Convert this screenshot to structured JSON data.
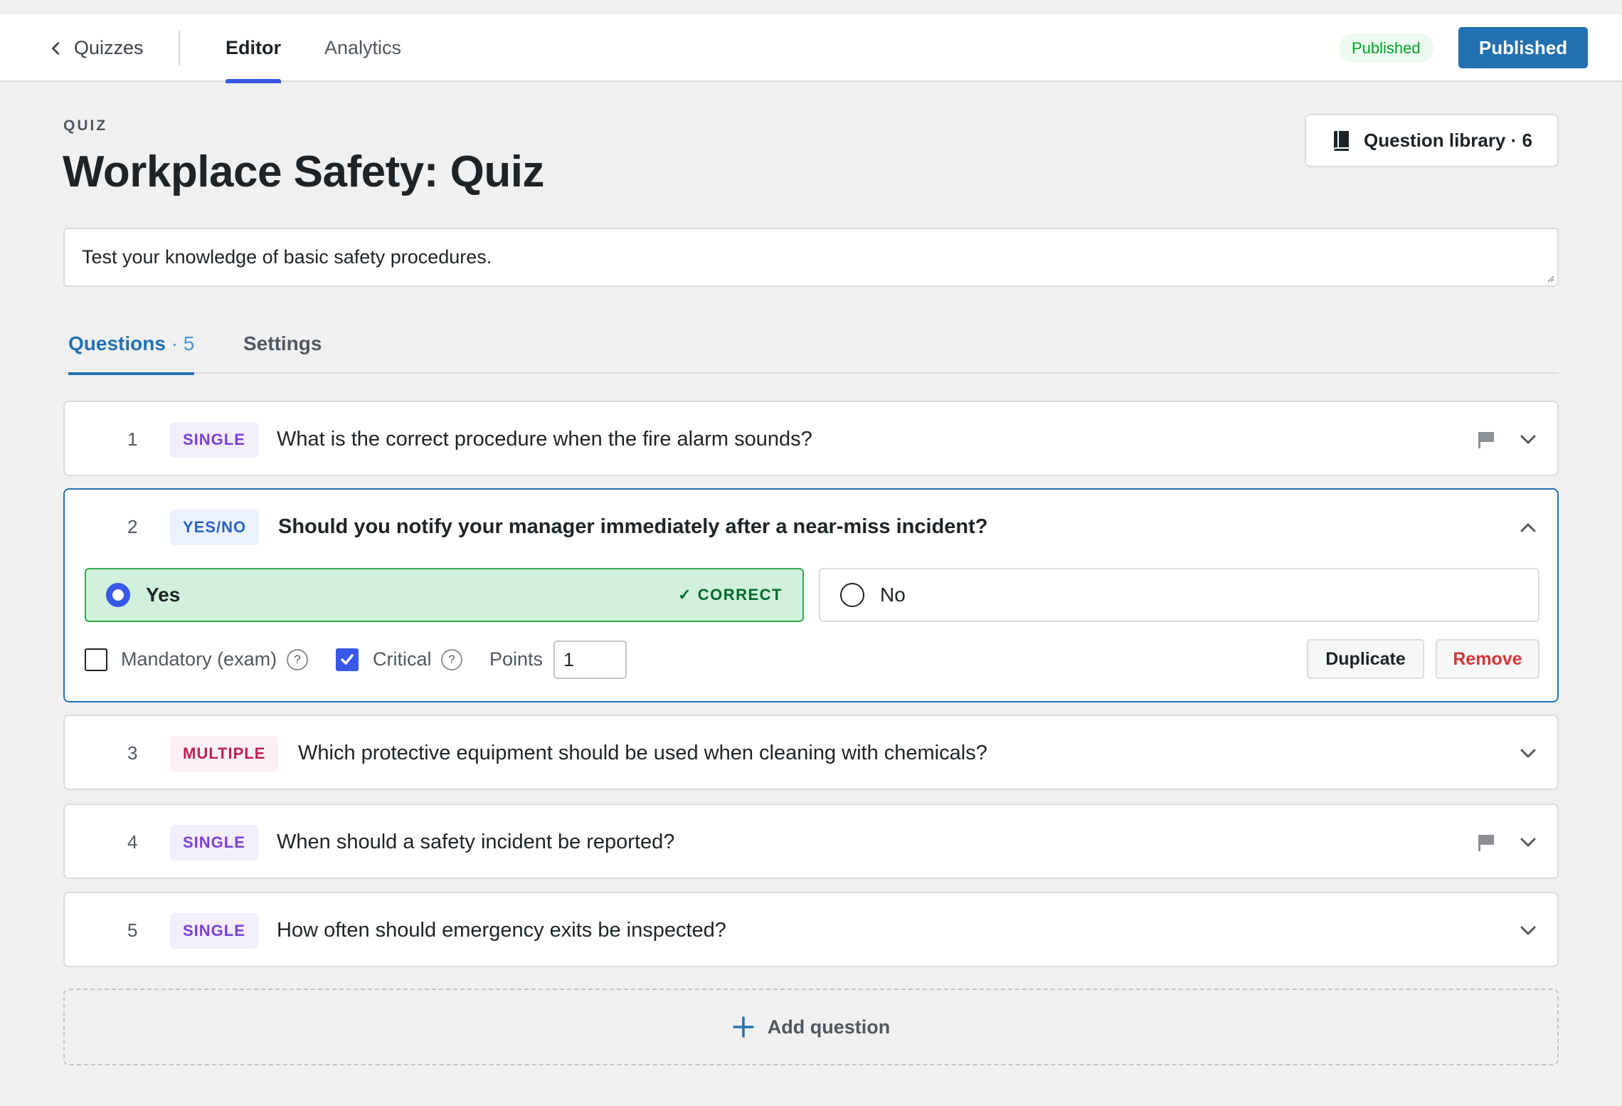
{
  "header": {
    "back_label": "Quizzes",
    "tabs": [
      {
        "label": "Editor",
        "active": true
      },
      {
        "label": "Analytics",
        "active": false
      }
    ],
    "status_badge": "Published",
    "publish_button": "Published"
  },
  "quiz": {
    "eyebrow": "QUIZ",
    "title": "Workplace Safety: Quiz",
    "description": "Test your knowledge of basic safety procedures.",
    "library_button": "Question library · 6"
  },
  "section_tabs": {
    "questions_label": "Questions",
    "questions_count": "· 5",
    "settings_label": "Settings"
  },
  "questions": [
    {
      "number": "1",
      "type": "SINGLE",
      "text": "What is the correct procedure when the fire alarm sounds?",
      "flagged": true,
      "expanded": false
    },
    {
      "number": "2",
      "type": "YES/NO",
      "text": "Should you notify your manager immediately after a near-miss incident?",
      "flagged": false,
      "expanded": true,
      "answers": [
        {
          "label": "Yes",
          "selected": true,
          "correct": true,
          "tag": "✓ CORRECT"
        },
        {
          "label": "No",
          "selected": false,
          "correct": false
        }
      ],
      "options": {
        "mandatory_label": "Mandatory (exam)",
        "mandatory_checked": false,
        "critical_label": "Critical",
        "critical_checked": true,
        "points_label": "Points",
        "points_value": "1",
        "help_glyph": "?"
      },
      "duplicate_button": "Duplicate",
      "remove_button": "Remove"
    },
    {
      "number": "3",
      "type": "MULTIPLE",
      "text": "Which protective equipment should be used when cleaning with chemicals?",
      "flagged": false,
      "expanded": false
    },
    {
      "number": "4",
      "type": "SINGLE",
      "text": "When should a safety incident be reported?",
      "flagged": true,
      "expanded": false
    },
    {
      "number": "5",
      "type": "SINGLE",
      "text": "How often should emergency exits be inspected?",
      "flagged": false,
      "expanded": false
    }
  ],
  "add_question_label": "Add question",
  "icons": {
    "back": "chevron-left-icon",
    "library": "book-icon",
    "flag": "flag-icon",
    "expand": "chevron-down-icon",
    "collapse": "chevron-up-icon",
    "add": "plus-icon"
  },
  "colors": {
    "primary": "#2271b1",
    "accent": "#3858e9",
    "success": "#00a32a",
    "danger": "#d63638"
  }
}
